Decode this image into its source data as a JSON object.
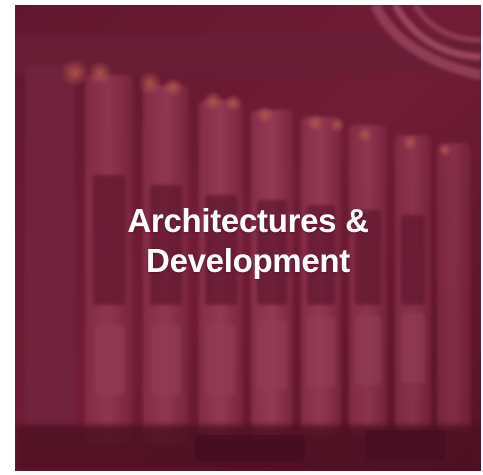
{
  "tile": {
    "title_line1": "Architectures &",
    "title_line2": "Development",
    "background_image": "server-rack-photo",
    "overlay_color": "#8a1a44"
  }
}
